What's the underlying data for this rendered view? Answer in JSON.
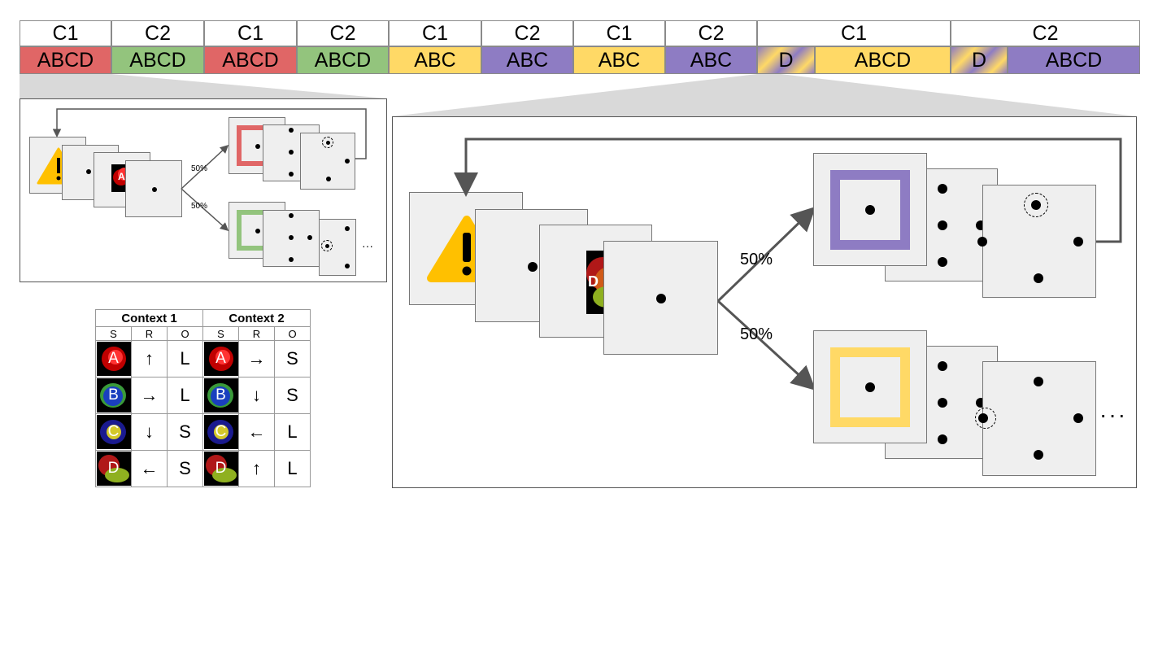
{
  "timeline": {
    "contexts": [
      {
        "label": "C1"
      },
      {
        "label": "C2"
      },
      {
        "label": "C1"
      },
      {
        "label": "C2"
      },
      {
        "label": "C1"
      },
      {
        "label": "C2"
      },
      {
        "label": "C1"
      },
      {
        "label": "C2"
      },
      {
        "label": "C1"
      },
      {
        "label": "C2"
      }
    ],
    "blocks": [
      {
        "label": "ABCD",
        "color": "#e06666"
      },
      {
        "label": "ABCD",
        "color": "#93c47d"
      },
      {
        "label": "ABCD",
        "color": "#e06666"
      },
      {
        "label": "ABCD",
        "color": "#93c47d"
      },
      {
        "label": "ABC",
        "color": "#ffd966"
      },
      {
        "label": "ABC",
        "color": "#8e7cc3"
      },
      {
        "label": "ABC",
        "color": "#ffd966"
      },
      {
        "label": "ABC",
        "color": "#8e7cc3"
      },
      {
        "label": "D",
        "color": "gradient"
      },
      {
        "label": "ABCD",
        "color": "#ffd966"
      },
      {
        "label": "D",
        "color": "gradient"
      },
      {
        "label": "ABCD",
        "color": "#8e7cc3"
      }
    ]
  },
  "small_panel": {
    "stimulus_letter": "A",
    "branch_top_prob": "50%",
    "branch_bottom_prob": "50%",
    "top_frame_color": "#e06666",
    "bottom_frame_color": "#93c47d",
    "ellipsis": "···"
  },
  "large_panel": {
    "stimulus_letter": "D",
    "branch_top_prob": "50%",
    "branch_bottom_prob": "50%",
    "top_frame_color": "#8e7cc3",
    "bottom_frame_color": "#ffd966",
    "ellipsis": "···"
  },
  "warning_icon": "warning-triangle-icon",
  "mapping_table": {
    "context1": "Context 1",
    "context2": "Context 2",
    "sub_headers": [
      "S",
      "R",
      "O",
      "S",
      "R",
      "O"
    ],
    "rows": [
      {
        "stim": "A",
        "r1": "↑",
        "o1": "L",
        "r2": "→",
        "o2": "S",
        "color": "#c00000",
        "color2": "#ff3333"
      },
      {
        "stim": "B",
        "r1": "→",
        "o1": "L",
        "r2": "↓",
        "o2": "S",
        "color": "#1a3fbf",
        "color2": "#3a9a3a"
      },
      {
        "stim": "C",
        "r1": "↓",
        "o1": "S",
        "r2": "←",
        "o2": "L",
        "color": "#1a1a8f",
        "color2": "#d4c82a"
      },
      {
        "stim": "D",
        "r1": "←",
        "o1": "S",
        "r2": "↑",
        "o2": "L",
        "color": "#b01818",
        "color2": "#8fb020"
      }
    ]
  }
}
